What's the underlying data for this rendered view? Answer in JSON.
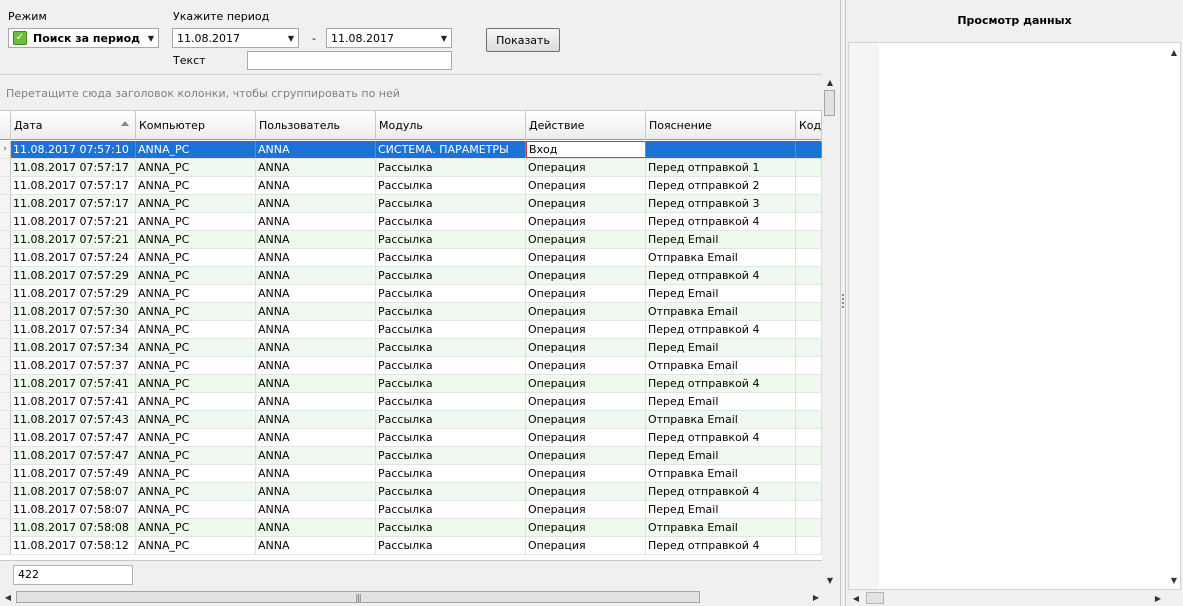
{
  "toolbar": {
    "mode_label": "Режим",
    "mode_value": "Поиск за период",
    "period_label": "Укажите период",
    "date_from": "11.08.2017",
    "date_separator": "-",
    "date_to": "11.08.2017",
    "text_label": "Текст",
    "text_value": "",
    "show_button": "Показать"
  },
  "grid": {
    "group_hint": "Перетащите сюда заголовок колонки, чтобы сгруппировать по ней",
    "columns": [
      "Дата",
      "Компьютер",
      "Пользователь",
      "Модуль",
      "Действие",
      "Пояснение",
      "Код"
    ],
    "rows": [
      [
        "11.08.2017 07:57:10",
        "ANNA_PC",
        "ANNA",
        "СИСТЕМА. ПАРАМЕТРЫ",
        "Вход",
        ""
      ],
      [
        "11.08.2017 07:57:17",
        "ANNA_PC",
        "ANNA",
        "Рассылка",
        "Операция",
        "Перед отправкой 1"
      ],
      [
        "11.08.2017 07:57:17",
        "ANNA_PC",
        "ANNA",
        "Рассылка",
        "Операция",
        "Перед отправкой 2"
      ],
      [
        "11.08.2017 07:57:17",
        "ANNA_PC",
        "ANNA",
        "Рассылка",
        "Операция",
        "Перед отправкой 3"
      ],
      [
        "11.08.2017 07:57:21",
        "ANNA_PC",
        "ANNA",
        "Рассылка",
        "Операция",
        "Перед отправкой 4"
      ],
      [
        "11.08.2017 07:57:21",
        "ANNA_PC",
        "ANNA",
        "Рассылка",
        "Операция",
        "Перед Email"
      ],
      [
        "11.08.2017 07:57:24",
        "ANNA_PC",
        "ANNA",
        "Рассылка",
        "Операция",
        "Отправка Email"
      ],
      [
        "11.08.2017 07:57:29",
        "ANNA_PC",
        "ANNA",
        "Рассылка",
        "Операция",
        "Перед отправкой 4"
      ],
      [
        "11.08.2017 07:57:29",
        "ANNA_PC",
        "ANNA",
        "Рассылка",
        "Операция",
        "Перед Email"
      ],
      [
        "11.08.2017 07:57:30",
        "ANNA_PC",
        "ANNA",
        "Рассылка",
        "Операция",
        "Отправка Email"
      ],
      [
        "11.08.2017 07:57:34",
        "ANNA_PC",
        "ANNA",
        "Рассылка",
        "Операция",
        "Перед отправкой 4"
      ],
      [
        "11.08.2017 07:57:34",
        "ANNA_PC",
        "ANNA",
        "Рассылка",
        "Операция",
        "Перед Email"
      ],
      [
        "11.08.2017 07:57:37",
        "ANNA_PC",
        "ANNA",
        "Рассылка",
        "Операция",
        "Отправка Email"
      ],
      [
        "11.08.2017 07:57:41",
        "ANNA_PC",
        "ANNA",
        "Рассылка",
        "Операция",
        "Перед отправкой 4"
      ],
      [
        "11.08.2017 07:57:41",
        "ANNA_PC",
        "ANNA",
        "Рассылка",
        "Операция",
        "Перед Email"
      ],
      [
        "11.08.2017 07:57:43",
        "ANNA_PC",
        "ANNA",
        "Рассылка",
        "Операция",
        "Отправка Email"
      ],
      [
        "11.08.2017 07:57:47",
        "ANNA_PC",
        "ANNA",
        "Рассылка",
        "Операция",
        "Перед отправкой 4"
      ],
      [
        "11.08.2017 07:57:47",
        "ANNA_PC",
        "ANNA",
        "Рассылка",
        "Операция",
        "Перед Email"
      ],
      [
        "11.08.2017 07:57:49",
        "ANNA_PC",
        "ANNA",
        "Рассылка",
        "Операция",
        "Отправка Email"
      ],
      [
        "11.08.2017 07:58:07",
        "ANNA_PC",
        "ANNA",
        "Рассылка",
        "Операция",
        "Перед отправкой 4"
      ],
      [
        "11.08.2017 07:58:07",
        "ANNA_PC",
        "ANNA",
        "Рассылка",
        "Операция",
        "Перед Email"
      ],
      [
        "11.08.2017 07:58:08",
        "ANNA_PC",
        "ANNA",
        "Рассылка",
        "Операция",
        "Отправка Email"
      ],
      [
        "11.08.2017 07:58:12",
        "ANNA_PC",
        "ANNA",
        "Рассылка",
        "Операция",
        "Перед отправкой 4"
      ]
    ],
    "selected_row": 0,
    "record_count": "422"
  },
  "preview": {
    "title": "Просмотр данных"
  },
  "colors": {
    "selection": "#1c73d6",
    "alt_row": "#f0f9ef",
    "focus_border": "#d13a3a"
  }
}
